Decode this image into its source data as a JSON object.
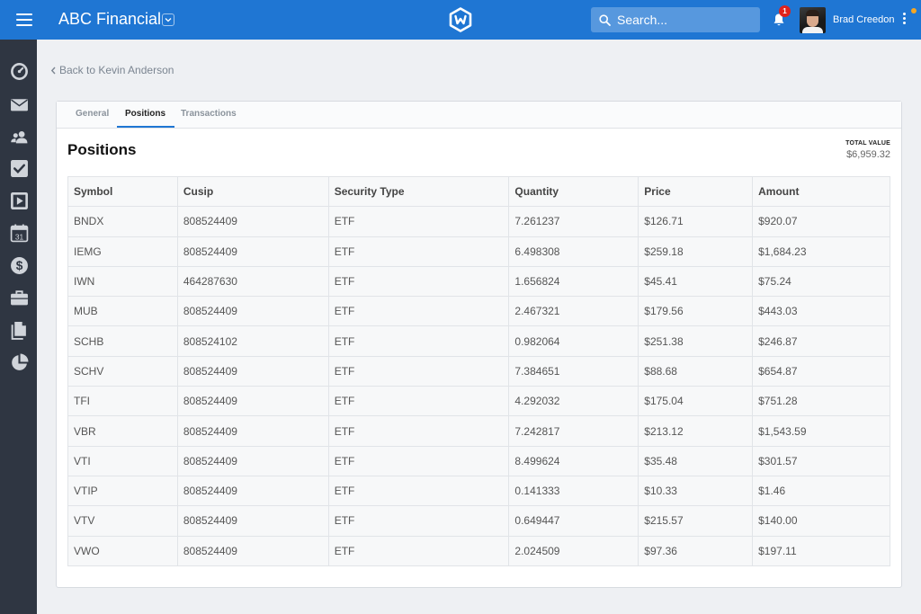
{
  "header": {
    "app_title": "ABC Financial",
    "search_placeholder": "Search...",
    "notification_count": "1",
    "user_name": "Brad Creedon",
    "brand_color": "#1f76d3"
  },
  "sidebar": {
    "icons": [
      "dashboard-icon",
      "mail-icon",
      "users-icon",
      "tasks-icon",
      "video-icon",
      "calendar-icon",
      "dollar-icon",
      "briefcase-icon",
      "documents-icon",
      "pie-chart-icon"
    ],
    "calendar_day": "31"
  },
  "breadcrumb": {
    "back_label": "Back to Kevin Anderson"
  },
  "tabs": [
    {
      "label": "General"
    },
    {
      "label": "Positions"
    },
    {
      "label": "Transactions"
    }
  ],
  "positions": {
    "title": "Positions",
    "total_label": "TOTAL VALUE",
    "total_value": "$6,959.32",
    "columns": [
      "Symbol",
      "Cusip",
      "Security Type",
      "Quantity",
      "Price",
      "Amount"
    ],
    "rows": [
      [
        "BNDX",
        "808524409",
        "ETF",
        "7.261237",
        "$126.71",
        "$920.07"
      ],
      [
        "IEMG",
        "808524409",
        "ETF",
        "6.498308",
        "$259.18",
        "$1,684.23"
      ],
      [
        "IWN",
        "464287630",
        "ETF",
        "1.656824",
        "$45.41",
        "$75.24"
      ],
      [
        "MUB",
        "808524409",
        "ETF",
        "2.467321",
        "$179.56",
        "$443.03"
      ],
      [
        "SCHB",
        "808524102",
        "ETF",
        "0.982064",
        "$251.38",
        "$246.87"
      ],
      [
        "SCHV",
        "808524409",
        "ETF",
        "7.384651",
        "$88.68",
        "$654.87"
      ],
      [
        "TFI",
        "808524409",
        "ETF",
        "4.292032",
        "$175.04",
        "$751.28"
      ],
      [
        "VBR",
        "808524409",
        "ETF",
        "7.242817",
        "$213.12",
        "$1,543.59"
      ],
      [
        "VTI",
        "808524409",
        "ETF",
        "8.499624",
        "$35.48",
        "$301.57"
      ],
      [
        "VTIP",
        "808524409",
        "ETF",
        "0.141333",
        "$10.33",
        "$1.46"
      ],
      [
        "VTV",
        "808524409",
        "ETF",
        "0.649447",
        "$215.57",
        "$140.00"
      ],
      [
        "VWO",
        "808524409",
        "ETF",
        "2.024509",
        "$97.36",
        "$197.11"
      ]
    ]
  }
}
